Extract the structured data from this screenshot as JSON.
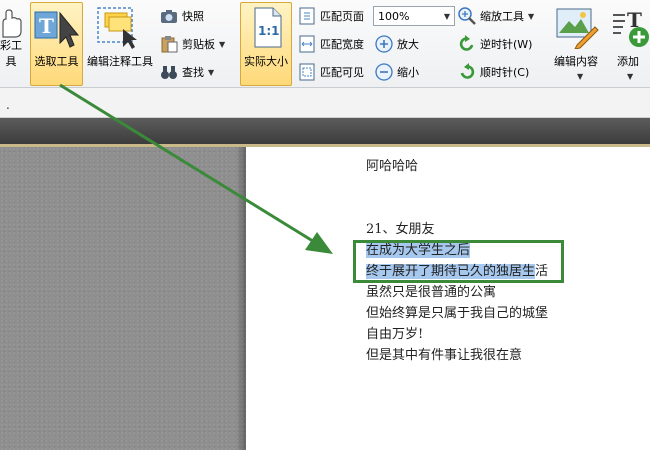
{
  "ribbon": {
    "hand_tool_label": "彩工具",
    "select_tool_label": "选取工具",
    "edit_annotation_label": "编辑注释工具",
    "snapshot_label": "快照",
    "clipboard_label": "剪贴板",
    "find_label": "查找",
    "actual_size_label": "实际大小",
    "actual_size_icon_text": "1:1",
    "fit_page_label": "匹配页面",
    "fit_width_label": "匹配宽度",
    "fit_visible_label": "匹配可见",
    "zoom_value": "100%",
    "zoom_in_label": "放大",
    "zoom_out_label": "缩小",
    "zoom_tool_label": "缩放工具",
    "rotate_left_label": "逆时针(W)",
    "rotate_right_label": "顺时针(C)",
    "edit_content_label": "编辑内容",
    "add_label": "添加"
  },
  "document": {
    "lines": [
      "阿哈哈哈",
      "21、女朋友",
      "在成为大学生之后",
      "终于展开了期待已久的独居生",
      "活",
      "虽然只是很普通的公寓",
      "但始终算是只属于我自己的城堡",
      "自由万岁!",
      "但是其中有件事让我很在意"
    ]
  },
  "colors": {
    "annotation_green": "#3a8a3a",
    "selection_blue": "#a7c8ee",
    "active_tool": "#ffd979"
  }
}
